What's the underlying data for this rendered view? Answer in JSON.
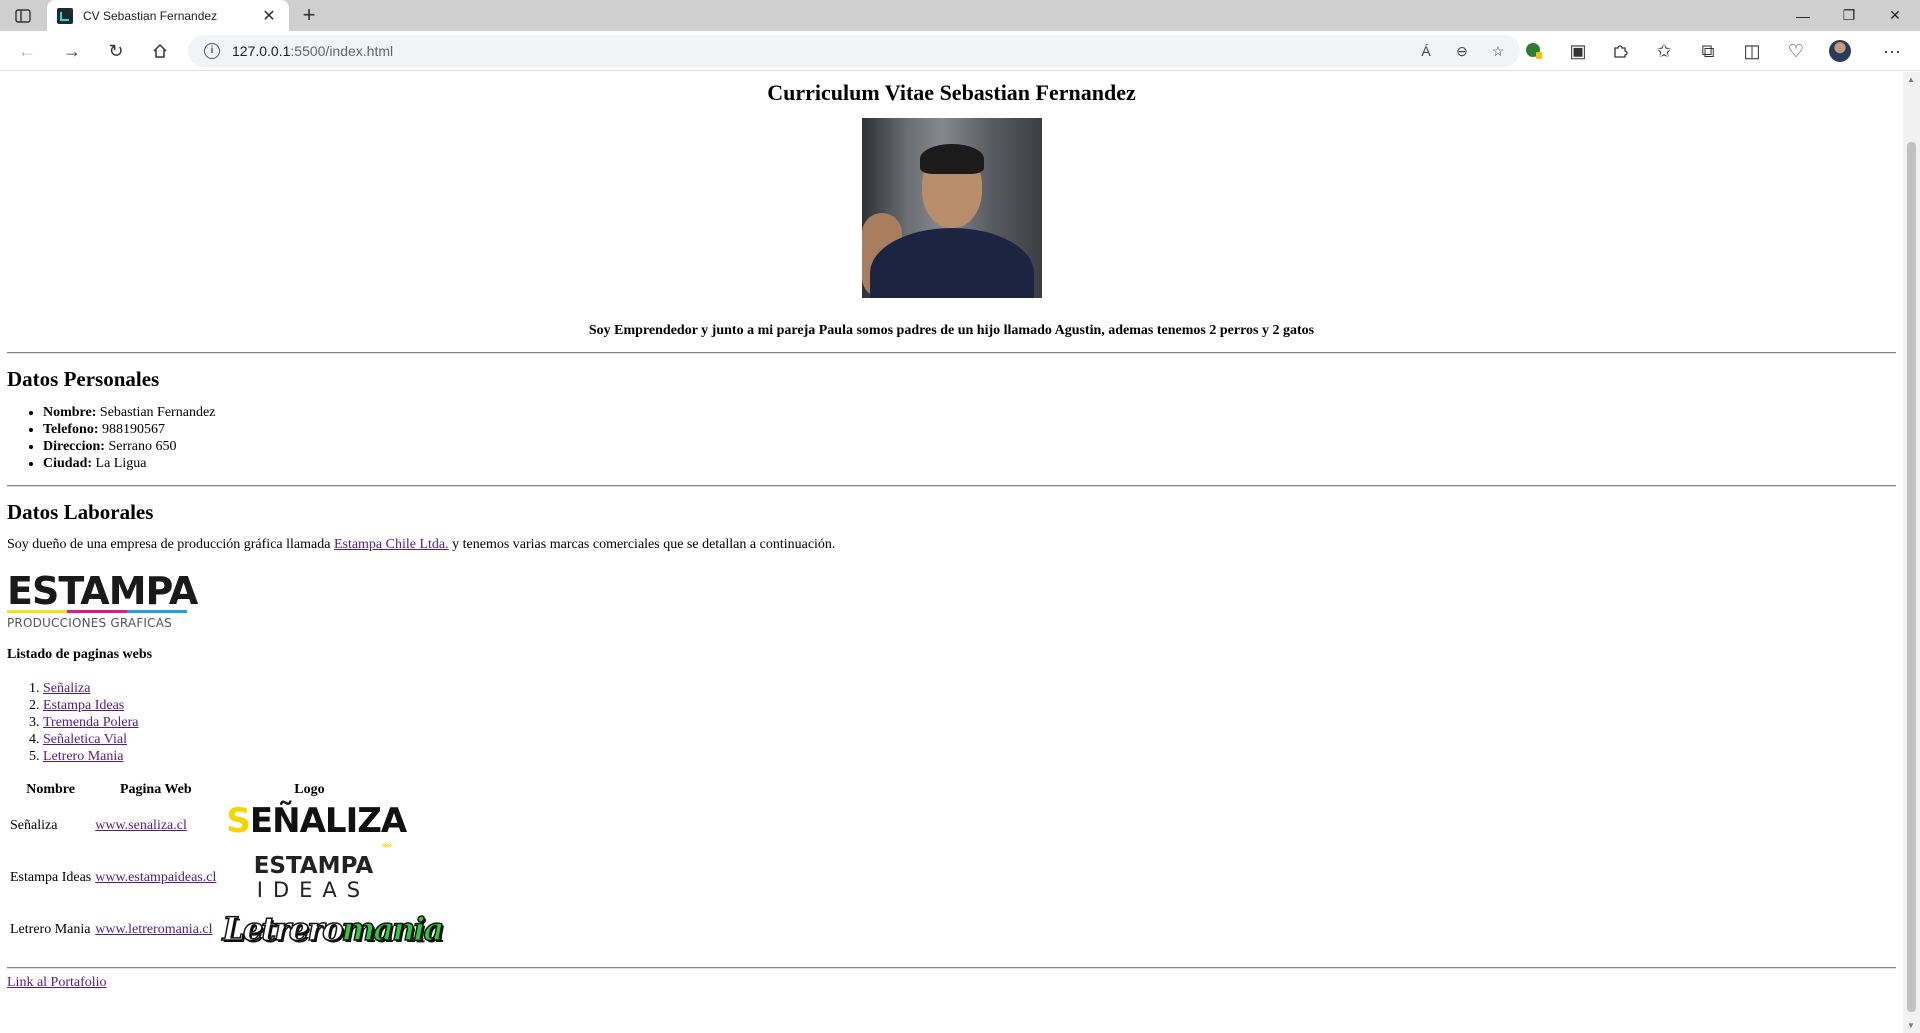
{
  "browser": {
    "tab_title": "CV Sebastian Fernandez",
    "url_host": "127.0.0.1",
    "url_path": ":5500/index.html",
    "icons": [
      "sidebar-icon",
      "close-icon",
      "plus-icon",
      "back-icon",
      "forward-icon",
      "refresh-icon",
      "home-icon",
      "info-icon",
      "read-aloud-icon",
      "zoom-out-icon",
      "add-favorite-icon",
      "extension-icon",
      "favorites-icon",
      "collections-icon",
      "profile-icon",
      "more-icon"
    ],
    "read_aloud_label": "Á",
    "more_label": "···"
  },
  "page": {
    "title": "Curriculum Vitae Sebastian Fernandez",
    "intro": "Soy Emprendedor y junto a mi pareja Paula somos padres de un hijo llamado Agustin, ademas tenemos 2 perros y 2 gatos",
    "personal": {
      "heading": "Datos Personales",
      "items": [
        {
          "label": "Nombre:",
          "value": " Sebastian Fernandez"
        },
        {
          "label": "Telefono:",
          "value": " 988190567"
        },
        {
          "label": "Direccion:",
          "value": " Serrano 650"
        },
        {
          "label": "Ciudad:",
          "value": " La Ligua"
        }
      ]
    },
    "work": {
      "heading": "Datos Laborales",
      "text_before": "Soy dueño de una empresa de producción gráfica llamada ",
      "company_link": "Estampa Chile Ltda.",
      "text_after": " y tenemos varias marcas comerciales que se detallan a continuación.",
      "logo": {
        "word": "ESTAMPA",
        "subtitle": "PRODUCCIONES GRAFICAS",
        "colors": [
          "#f4e21c",
          "#e5197f",
          "#1ea1e0"
        ]
      }
    },
    "websites": {
      "heading": "Listado de paginas webs",
      "items": [
        "Señaliza",
        "Estampa Ideas",
        "Tremenda Polera",
        "Señaletica Vial",
        "Letrero Mania"
      ]
    },
    "table": {
      "headers": [
        "Nombre",
        "Pagina Web",
        "Logo"
      ],
      "rows": [
        {
          "name": "Señaliza",
          "url": "www.senaliza.cl",
          "logo_a": "S",
          "logo_b": "EÑALIZA",
          "logo_tail": "»»»"
        },
        {
          "name": "Estampa Ideas",
          "url": "www.estampaideas.cl",
          "logo_a": "ESTAMPA",
          "logo_b": "IDEAS",
          "logo_tail": ""
        },
        {
          "name": "Letrero Mania",
          "url": "www.letreromania.cl",
          "logo_a": "Letrero",
          "logo_b": "mania",
          "logo_tail": ""
        }
      ]
    },
    "portfolio_link": "Link al Portafolio"
  }
}
